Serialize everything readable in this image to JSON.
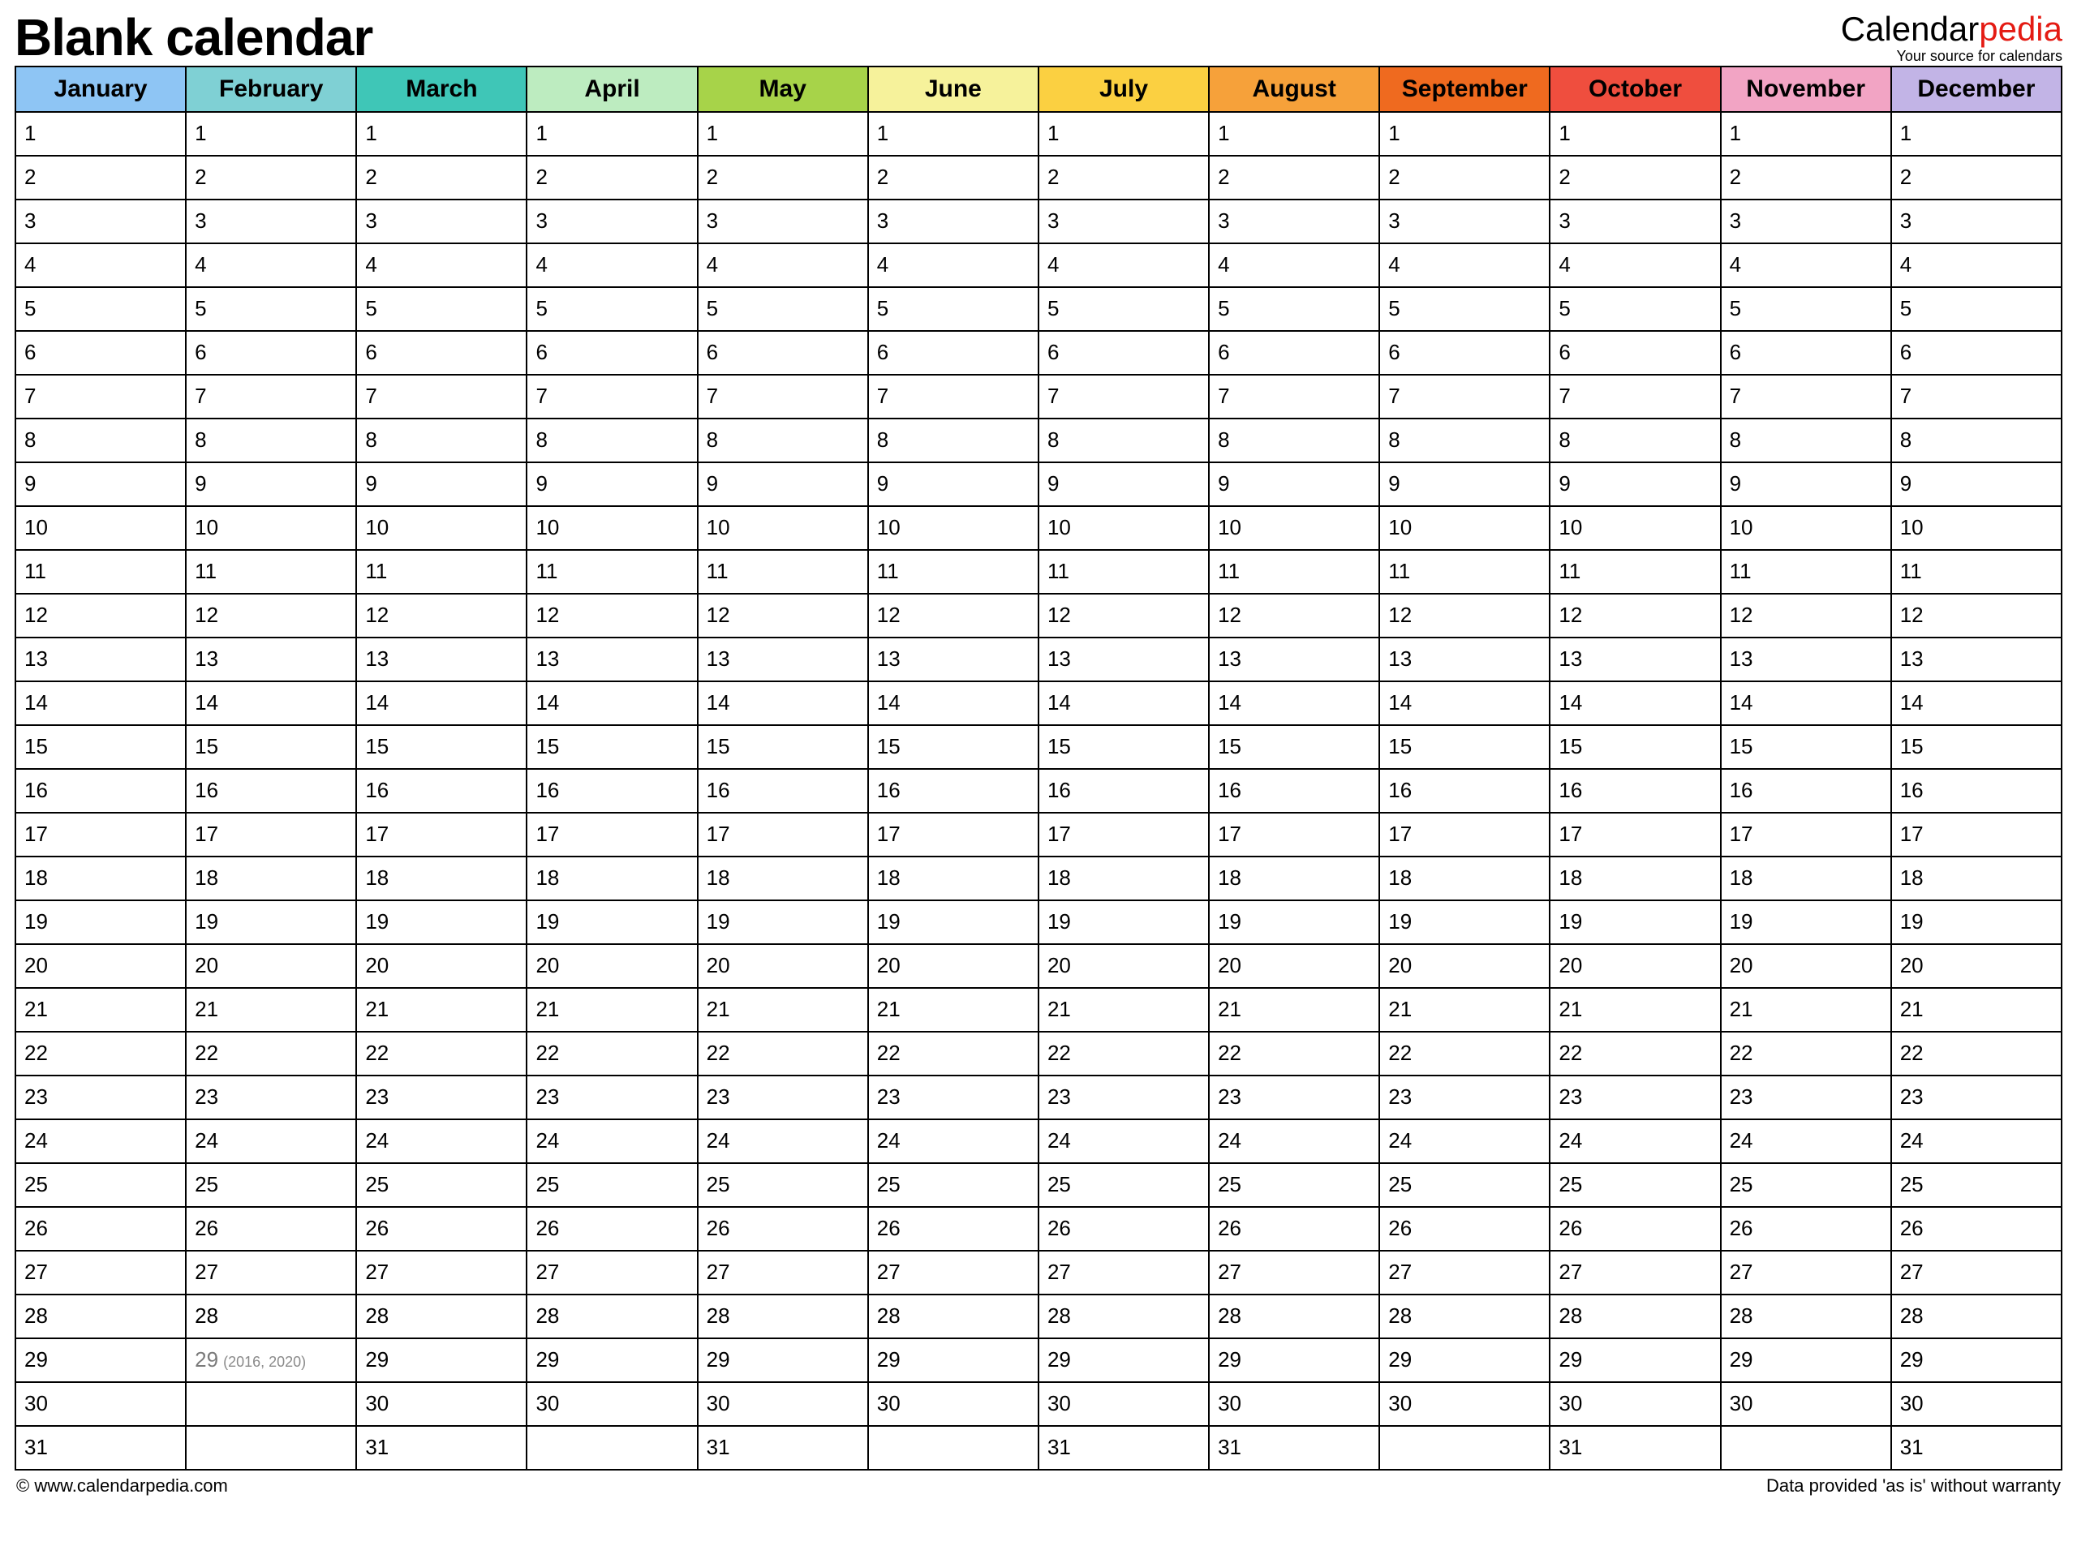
{
  "title": "Blank calendar",
  "brand": {
    "name_black": "Calendar",
    "name_accent": "pedia",
    "tagline": "Your source for calendars"
  },
  "months": [
    {
      "name": "January",
      "color": "#8ec5f4",
      "days": 31
    },
    {
      "name": "February",
      "color": "#7fd0d4",
      "days": 29,
      "leap_day": 29,
      "leap_note": "(2016, 2020)"
    },
    {
      "name": "March",
      "color": "#3fc6b7",
      "days": 31
    },
    {
      "name": "April",
      "color": "#bdecc0",
      "days": 30
    },
    {
      "name": "May",
      "color": "#a7d349",
      "days": 31
    },
    {
      "name": "June",
      "color": "#f6f29b",
      "days": 30
    },
    {
      "name": "July",
      "color": "#fbd041",
      "days": 31
    },
    {
      "name": "August",
      "color": "#f6a13a",
      "days": 31
    },
    {
      "name": "September",
      "color": "#ef6a1f",
      "days": 30
    },
    {
      "name": "October",
      "color": "#ef4e3e",
      "days": 31
    },
    {
      "name": "November",
      "color": "#f2a4c4",
      "days": 30
    },
    {
      "name": "December",
      "color": "#c2b4e6",
      "days": 31
    }
  ],
  "max_rows": 31,
  "footer": {
    "left": "© www.calendarpedia.com",
    "right": "Data provided 'as is' without warranty"
  }
}
